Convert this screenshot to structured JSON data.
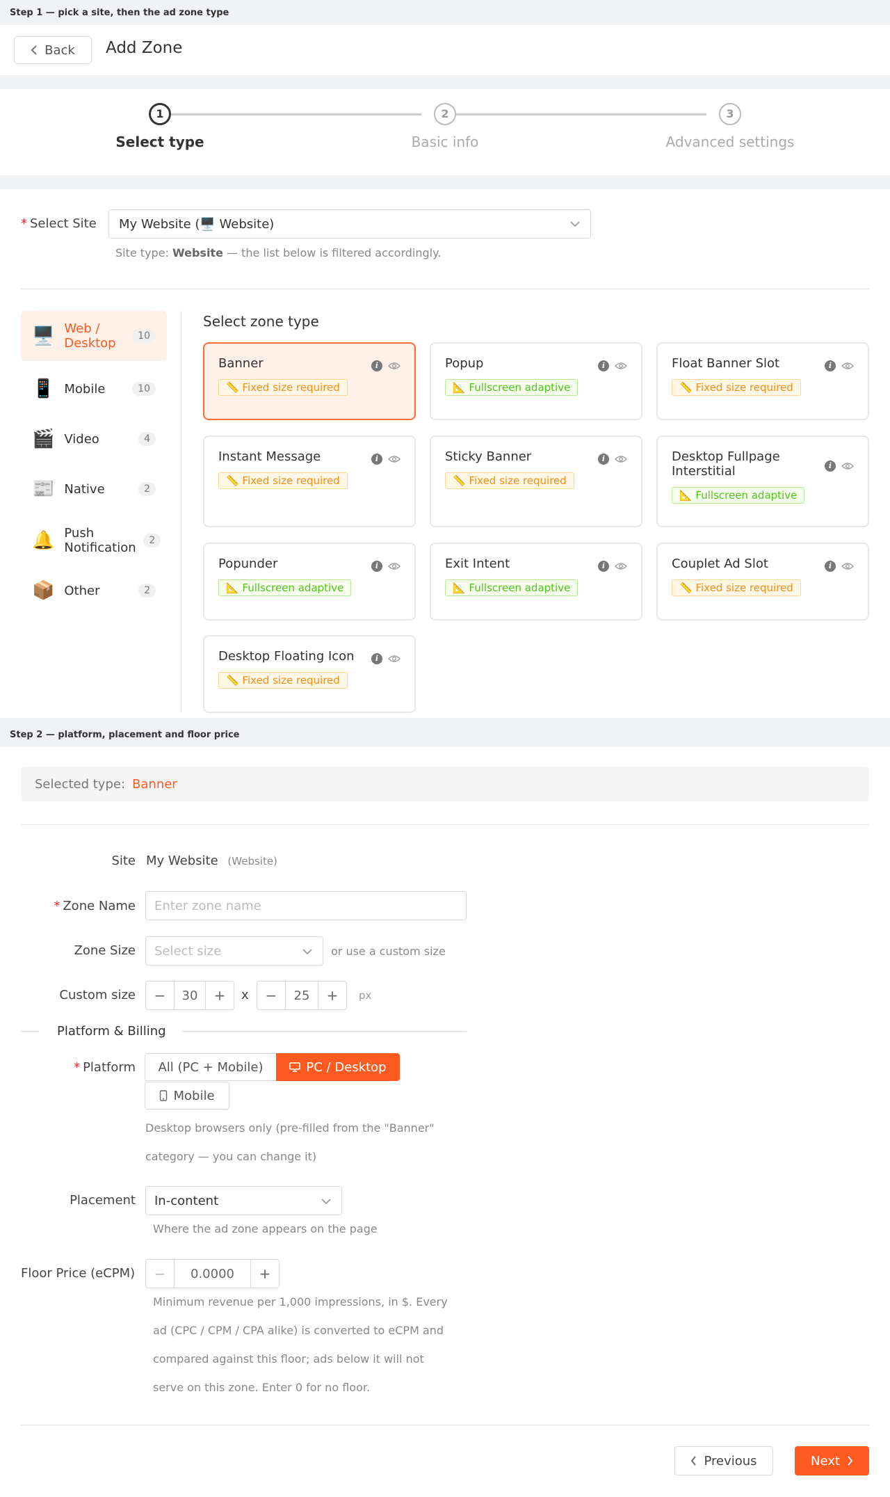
{
  "step1_caption": "Step 1 — pick a site, then the ad zone type",
  "step2_caption": "Step 2 — platform, placement and floor price",
  "header": {
    "back_label": "Back",
    "title": "Add Zone"
  },
  "steps": [
    {
      "num": "1",
      "label": "Select type"
    },
    {
      "num": "2",
      "label": "Basic info"
    },
    {
      "num": "3",
      "label": "Advanced settings"
    }
  ],
  "site": {
    "label": "Select Site",
    "value": "My Website (🖥️ Website)",
    "hint_prefix": "Site type:",
    "hint_type": "Website",
    "hint_suffix": "— the list below is filtered accordingly."
  },
  "categories": [
    {
      "icon": "🖥️",
      "name": "Web / Desktop",
      "count": "10"
    },
    {
      "icon": "📱",
      "name": "Mobile",
      "count": "10"
    },
    {
      "icon": "🎬",
      "name": "Video",
      "count": "4"
    },
    {
      "icon": "📰",
      "name": "Native",
      "count": "2"
    },
    {
      "icon": "🔔",
      "name": "Push Notification",
      "count": "2"
    },
    {
      "icon": "📦",
      "name": "Other",
      "count": "2"
    }
  ],
  "zone_type_title": "Select zone type",
  "zones": [
    {
      "name": "Banner",
      "tag": "📏 Fixed size required"
    },
    {
      "name": "Popup",
      "tag": "📐 Fullscreen adaptive"
    },
    {
      "name": "Float Banner Slot",
      "tag": "📏 Fixed size required"
    },
    {
      "name": "Instant Message",
      "tag": "📏 Fixed size required"
    },
    {
      "name": "Sticky Banner",
      "tag": "📏 Fixed size required"
    },
    {
      "name": "Desktop Fullpage Interstitial",
      "tag": "📐 Fullscreen adaptive"
    },
    {
      "name": "Popunder",
      "tag": "📐 Fullscreen adaptive"
    },
    {
      "name": "Exit Intent",
      "tag": "📐 Fullscreen adaptive"
    },
    {
      "name": "Couplet Ad Slot",
      "tag": "📏 Fixed size required"
    },
    {
      "name": "Desktop Floating Icon",
      "tag": "📏 Fixed size required"
    }
  ],
  "selected_type": {
    "label": "Selected type:",
    "value": "Banner"
  },
  "form": {
    "site_label": "Site",
    "site_value": "My Website",
    "site_type": "(Website)",
    "zone_name_label": "Zone Name",
    "zone_name_placeholder": "Enter zone name",
    "zone_size_label": "Zone Size",
    "zone_size_placeholder": "Select size",
    "zone_size_hint": "or use a custom size",
    "custom_size_label": "Custom size",
    "width_value": "30",
    "times": "x",
    "height_value": "25",
    "unit": "px",
    "section_title": "Platform & Billing",
    "platform_label": "Platform",
    "platform_options": [
      "All (PC + Mobile)",
      "PC / Desktop",
      "Mobile"
    ],
    "platform_help_1": "Desktop browsers only (pre-filled from the \"Banner\"",
    "platform_help_2": "category — you can change it)",
    "placement_label": "Placement",
    "placement_value": "In-content",
    "placement_help": "Where the ad zone appears on the page",
    "floor_label": "Floor Price (eCPM)",
    "floor_value": "0.0000",
    "floor_help_1": "Minimum revenue per 1,000 impressions, in $. Every",
    "floor_help_2": "ad (CPC / CPM / CPA alike) is converted to eCPM and",
    "floor_help_3": "compared against this floor; ads below it will not",
    "floor_help_4": "serve on this zone. Enter 0 for no floor."
  },
  "footer": {
    "prev_label": "Previous",
    "next_label": "Next"
  },
  "colors": {
    "accent": "#ff5a1f",
    "selected_bg": "#fff0e8"
  }
}
